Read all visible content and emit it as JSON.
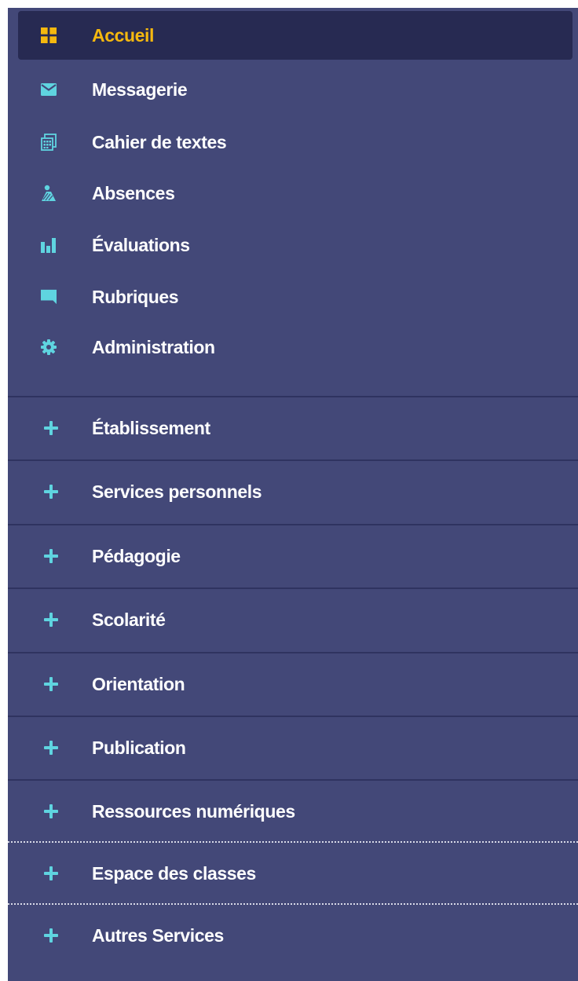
{
  "colors": {
    "sidebar_bg": "#434878",
    "active_bg": "#272a52",
    "active_text": "#f5b80f",
    "icon_accent": "#5fd4e0",
    "text": "#ffffff"
  },
  "main_nav": [
    {
      "label": "Accueil",
      "icon": "dashboard-grid-icon",
      "active": true
    },
    {
      "label": "Messagerie",
      "icon": "envelope-icon"
    },
    {
      "label": "Cahier de textes",
      "icon": "calendar-book-icon"
    },
    {
      "label": "Absences",
      "icon": "person-icon"
    },
    {
      "label": "Évaluations",
      "icon": "bar-chart-icon"
    },
    {
      "label": "Rubriques",
      "icon": "chat-bubble-icon"
    },
    {
      "label": "Administration",
      "icon": "gear-icon"
    }
  ],
  "sections": [
    {
      "label": "Établissement",
      "icon": "plus-icon"
    },
    {
      "label": "Services personnels",
      "icon": "plus-icon"
    },
    {
      "label": "Pédagogie",
      "icon": "plus-icon"
    },
    {
      "label": "Scolarité",
      "icon": "plus-icon"
    },
    {
      "label": "Orientation",
      "icon": "plus-icon"
    },
    {
      "label": "Publication",
      "icon": "plus-icon"
    },
    {
      "label": "Ressources numériques",
      "icon": "plus-icon"
    },
    {
      "label": "Espace des classes",
      "icon": "plus-icon"
    },
    {
      "label": "Autres Services",
      "icon": "plus-icon"
    }
  ]
}
